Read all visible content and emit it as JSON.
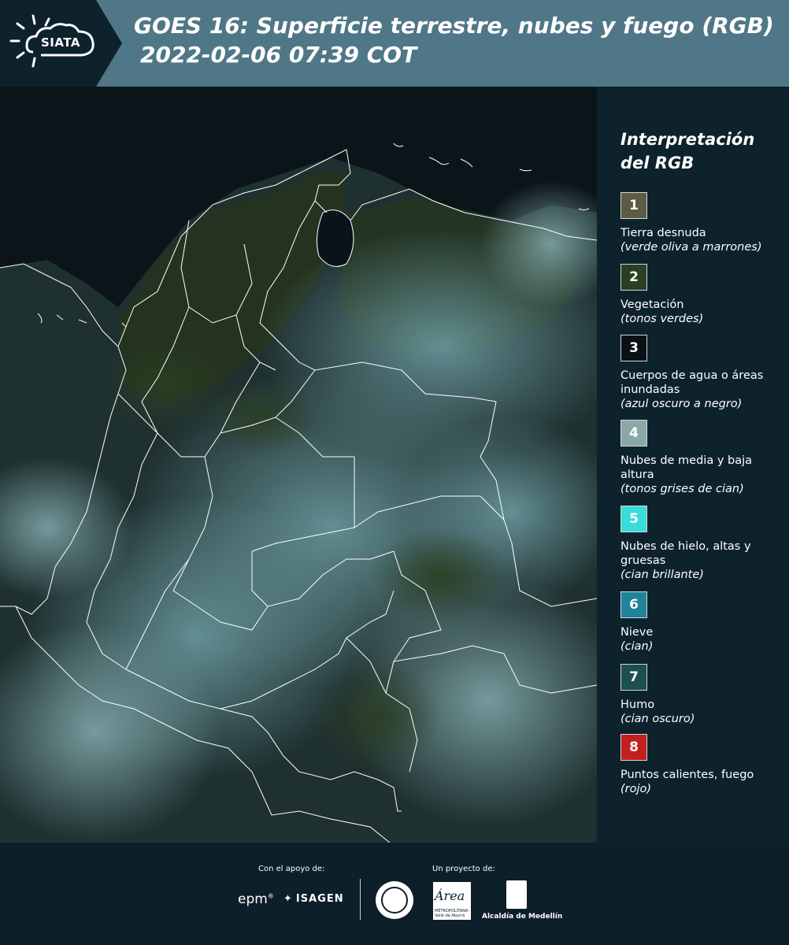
{
  "header": {
    "logo_text": "SIATA",
    "title_line1": "GOES 16: Superficie terrestre, nubes y fuego (RGB)",
    "title_line2": "2022-02-06 07:39 COT",
    "bg_color": "#4f7787"
  },
  "legend": {
    "title": "Interpretación del RGB",
    "items": [
      {
        "number": "1",
        "label": "Tierra desnuda",
        "desc": "(verde oliva a marrones)",
        "color": "#5c5b43"
      },
      {
        "number": "2",
        "label": "Vegetación",
        "desc": "(tonos verdes)",
        "color": "#2b3f22"
      },
      {
        "number": "3",
        "label": "Cuerpos de agua o áreas inundadas",
        "desc": "(azul oscuro a negro)",
        "color": "#0a1116"
      },
      {
        "number": "4",
        "label": "Nubes de media y baja altura",
        "desc": "(tonos grises de cian)",
        "color": "#8aa9a6"
      },
      {
        "number": "5",
        "label": "Nubes de hielo, altas y gruesas",
        "desc": "(cian brillante)",
        "color": "#39dcd8"
      },
      {
        "number": "6",
        "label": "Nieve",
        "desc": "(cian)",
        "color": "#20839a"
      },
      {
        "number": "7",
        "label": "Humo",
        "desc": "(cian oscuro)",
        "color": "#1e4f50"
      },
      {
        "number": "8",
        "label": "Puntos calientes, fuego",
        "desc": "(rojo)",
        "color": "#c1201f"
      }
    ]
  },
  "footer": {
    "support_label": "Con el apoyo de:",
    "project_label": "Un proyecto de:",
    "epm": "epm",
    "isagen": "ISAGEN",
    "amva_logo": "Área",
    "amva_sub": "METROPOLITANA · Valle de Aburrá",
    "alcaldia": "Alcaldía de Medellín"
  },
  "map": {
    "description_icon": "satellite-rgb-composite",
    "border_color": "#ffffff",
    "ocean_color": "#0a1418"
  }
}
